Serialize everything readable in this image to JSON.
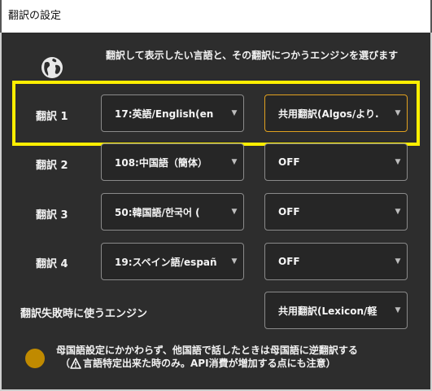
{
  "window": {
    "title": "翻訳の設定"
  },
  "description": "翻訳して表示したい言語と、その翻訳につかうエンジンを選びます",
  "rows": [
    {
      "label": "翻訳 1",
      "language": "17:英語/English(en",
      "engine": "共用翻訳(Algos/より."
    },
    {
      "label": "翻訳 2",
      "language": "108:中国語（簡体）",
      "engine": "OFF"
    },
    {
      "label": "翻訳 3",
      "language": "50:韓国語/한국어 (",
      "engine": "OFF"
    },
    {
      "label": "翻訳 4",
      "language": "19:スペイン語/españ",
      "engine": "OFF"
    }
  ],
  "fallback": {
    "label": "翻訳失敗時に使うエンジン",
    "engine": "共用翻訳(Lexicon/軽"
  },
  "reverse_translation": {
    "line1": "母国語設定にかかわらず、他国語で話したときは母国語に逆翻訳する",
    "line2_prefix": "（",
    "line2": "言語特定出来た時のみ。API消費が増加する点にも注意）",
    "toggle_color": "#c08a00"
  },
  "colors": {
    "highlight": "#ffee00",
    "active_border": "#e0a020",
    "background": "#2d2d2d"
  }
}
